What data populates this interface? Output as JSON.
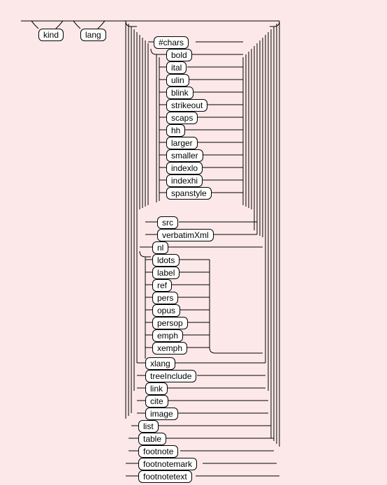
{
  "nodes": {
    "kind": "kind",
    "lang": "lang",
    "chars": "#chars",
    "bold": "bold",
    "ital": "ital",
    "ulin": "ulin",
    "blink": "blink",
    "strikeout": "strikeout",
    "scaps": "scaps",
    "hh": "hh",
    "larger": "larger",
    "smaller": "smaller",
    "indexlo": "indexlo",
    "indexhi": "indexhi",
    "spanstyle": "spanstyle",
    "src": "src",
    "verbatimXml": "verbatimXml",
    "nl": "nl",
    "ldots": "ldots",
    "label": "label",
    "ref": "ref",
    "pers": "pers",
    "opus": "opus",
    "persop": "persop",
    "emph": "emph",
    "xemph": "xemph",
    "xlang": "xlang",
    "treeInclude": "treeInclude",
    "link": "link",
    "cite": "cite",
    "image": "image",
    "list": "list",
    "table": "table",
    "footnote": "footnote",
    "footnotemark": "footnotemark",
    "footnotetext": "footnotetext"
  }
}
